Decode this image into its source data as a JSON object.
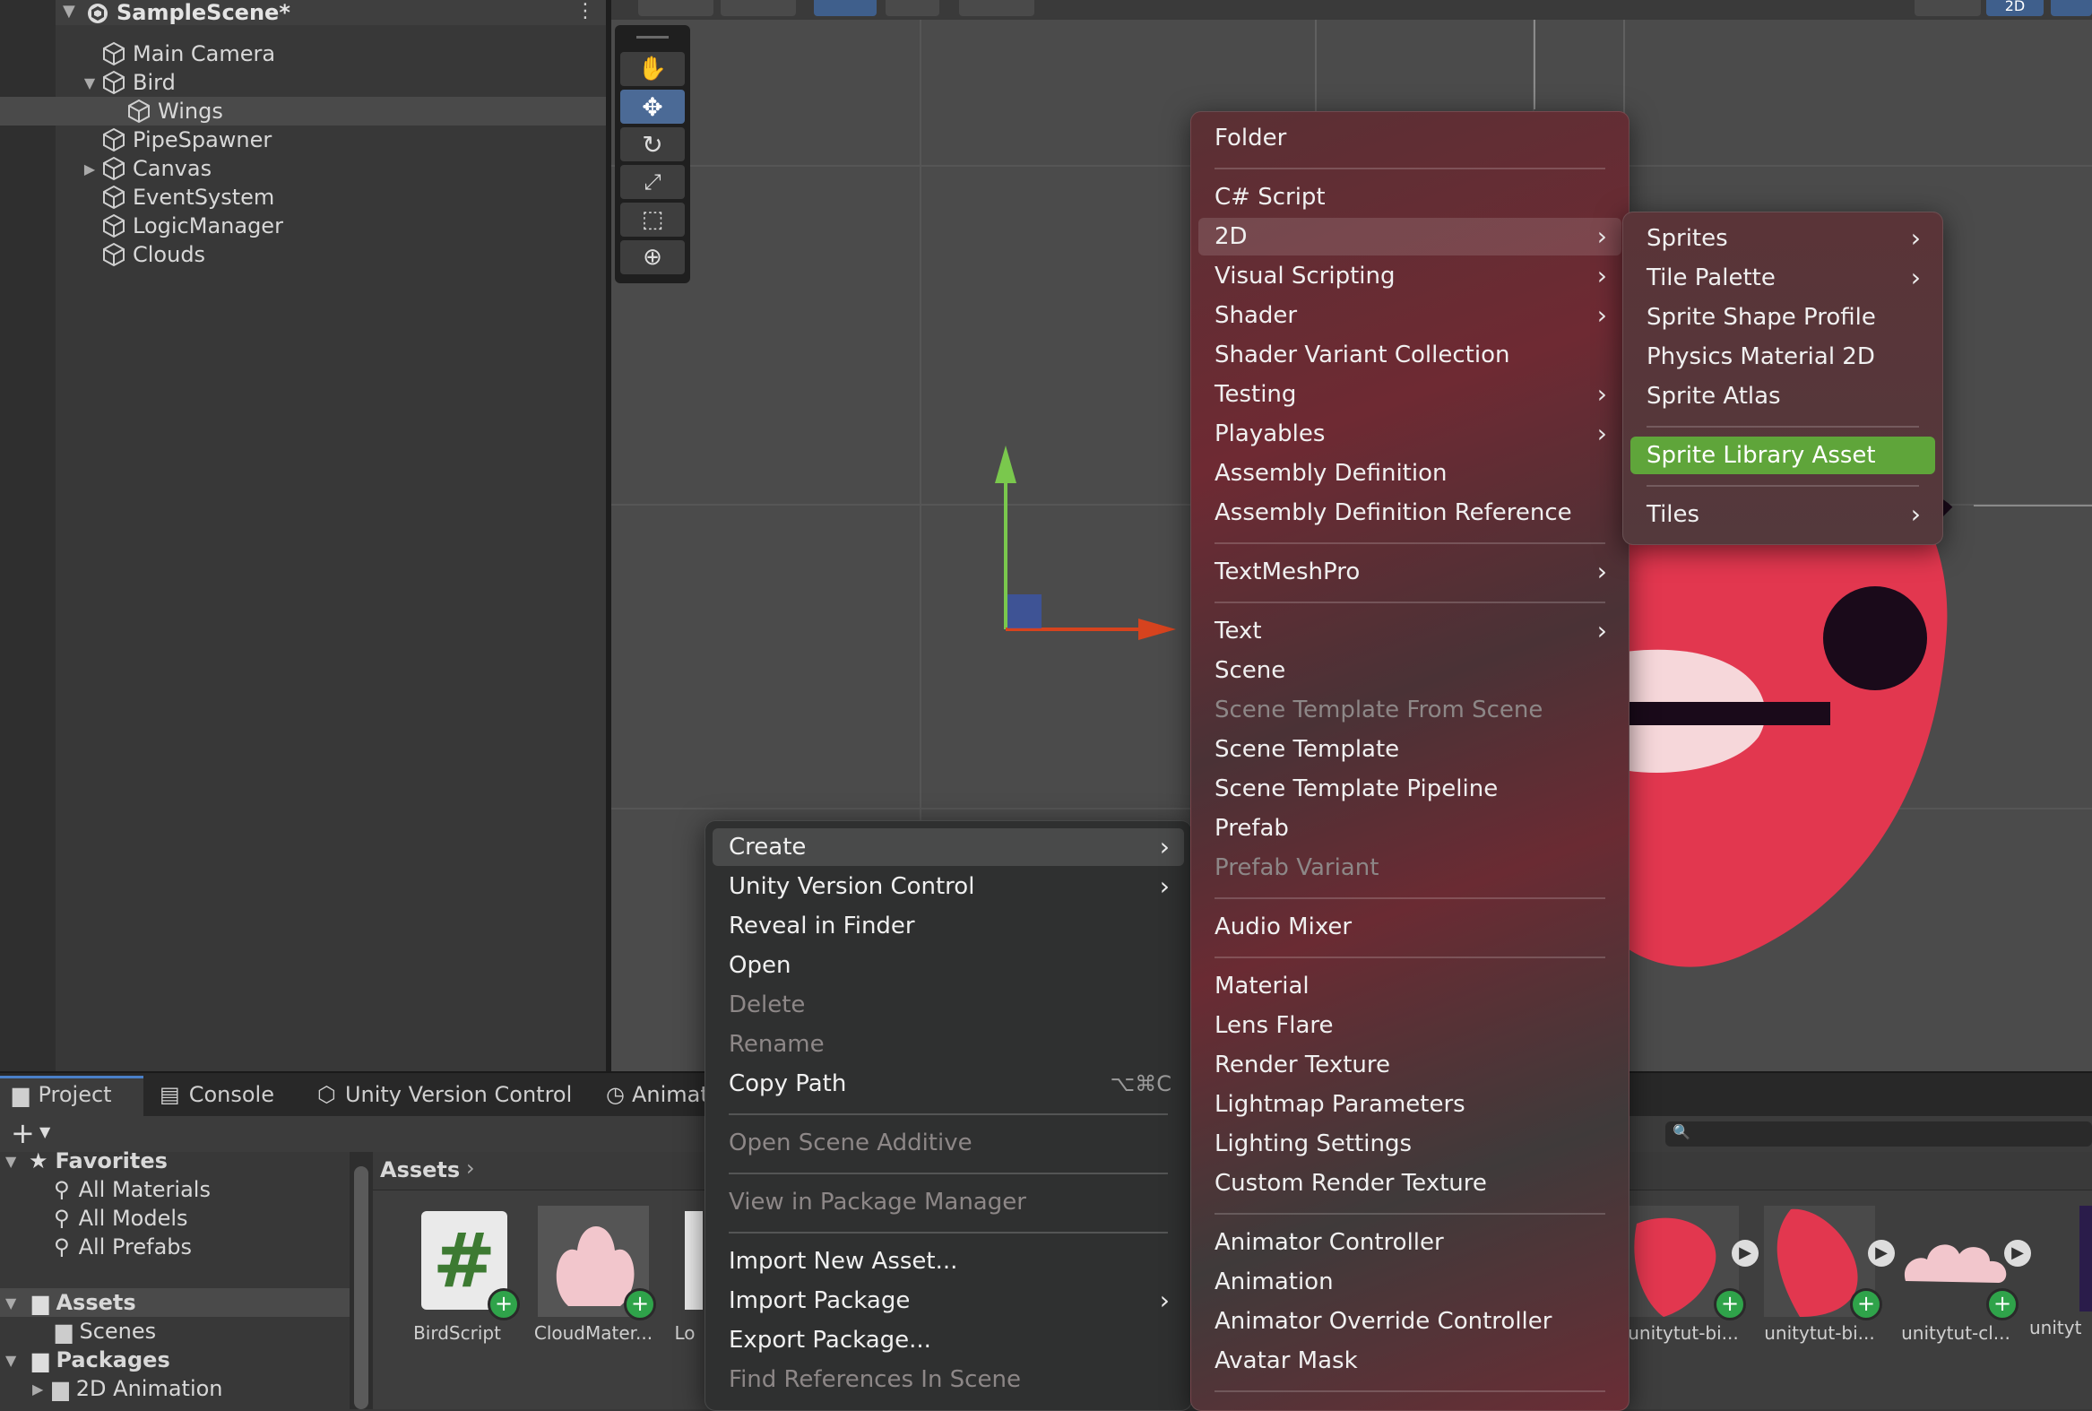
{
  "hierarchy": {
    "scene": "SampleScene*",
    "items": [
      {
        "label": "Main Camera",
        "indent": 1,
        "expander": "",
        "selected": false
      },
      {
        "label": "Bird",
        "indent": 1,
        "expander": "▼",
        "selected": false
      },
      {
        "label": "Wings",
        "indent": 2,
        "expander": "",
        "selected": true
      },
      {
        "label": "PipeSpawner",
        "indent": 1,
        "expander": "",
        "selected": false
      },
      {
        "label": "Canvas",
        "indent": 1,
        "expander": "▶",
        "selected": false
      },
      {
        "label": "EventSystem",
        "indent": 1,
        "expander": "",
        "selected": false
      },
      {
        "label": "LogicManager",
        "indent": 1,
        "expander": "",
        "selected": false
      },
      {
        "label": "Clouds",
        "indent": 1,
        "expander": "",
        "selected": false
      }
    ]
  },
  "scene_toolbar": {
    "mode_2d": "2D"
  },
  "tools": [
    "hand-tool-icon",
    "move-tool-icon",
    "rotate-tool-icon",
    "scale-tool-icon",
    "rect-tool-icon",
    "transform-tool-icon"
  ],
  "bottom_tabs": [
    "Project",
    "Console",
    "Unity Version Control",
    "Animat"
  ],
  "project": {
    "favorites_label": "Favorites",
    "favorites": [
      "All Materials",
      "All Models",
      "All Prefabs"
    ],
    "assets_label": "Assets",
    "assets_children": [
      "Scenes"
    ],
    "packages_label": "Packages",
    "packages_children": [
      "2D Animation"
    ],
    "breadcrumb": "Assets",
    "assets": [
      "BirdScript",
      "CloudMater...",
      "Lo",
      "unitytut-bi...",
      "unitytut-bi...",
      "unitytut-cl...",
      "unityt"
    ]
  },
  "menu_main": [
    {
      "label": "Create",
      "sub": true,
      "state": "hl"
    },
    {
      "label": "Unity Version Control",
      "sub": true
    },
    {
      "label": "Reveal in Finder"
    },
    {
      "label": "Open"
    },
    {
      "label": "Delete",
      "state": "dis"
    },
    {
      "label": "Rename",
      "state": "dis"
    },
    {
      "label": "Copy Path",
      "shortcut": "⌥⌘C"
    },
    {
      "sep": true
    },
    {
      "label": "Open Scene Additive",
      "state": "dis"
    },
    {
      "sep": true
    },
    {
      "label": "View in Package Manager",
      "state": "dis"
    },
    {
      "sep": true
    },
    {
      "label": "Import New Asset..."
    },
    {
      "label": "Import Package",
      "sub": true
    },
    {
      "label": "Export Package..."
    },
    {
      "label": "Find References In Scene",
      "state": "dis"
    }
  ],
  "menu_create": [
    {
      "label": "Folder"
    },
    {
      "sep": true
    },
    {
      "label": "C# Script"
    },
    {
      "label": "2D",
      "sub": true,
      "state": "hl"
    },
    {
      "label": "Visual Scripting",
      "sub": true
    },
    {
      "label": "Shader",
      "sub": true
    },
    {
      "label": "Shader Variant Collection"
    },
    {
      "label": "Testing",
      "sub": true
    },
    {
      "label": "Playables",
      "sub": true
    },
    {
      "label": "Assembly Definition"
    },
    {
      "label": "Assembly Definition Reference"
    },
    {
      "sep": true
    },
    {
      "label": "TextMeshPro",
      "sub": true
    },
    {
      "sep": true
    },
    {
      "label": "Text",
      "sub": true
    },
    {
      "label": "Scene"
    },
    {
      "label": "Scene Template From Scene",
      "state": "dis"
    },
    {
      "label": "Scene Template"
    },
    {
      "label": "Scene Template Pipeline"
    },
    {
      "label": "Prefab"
    },
    {
      "label": "Prefab Variant",
      "state": "dis"
    },
    {
      "sep": true
    },
    {
      "label": "Audio Mixer"
    },
    {
      "sep": true
    },
    {
      "label": "Material"
    },
    {
      "label": "Lens Flare"
    },
    {
      "label": "Render Texture"
    },
    {
      "label": "Lightmap Parameters"
    },
    {
      "label": "Lighting Settings"
    },
    {
      "label": "Custom Render Texture"
    },
    {
      "sep": true
    },
    {
      "label": "Animator Controller"
    },
    {
      "label": "Animation"
    },
    {
      "label": "Animator Override Controller"
    },
    {
      "label": "Avatar Mask"
    },
    {
      "sep": true
    }
  ],
  "menu_2d": [
    {
      "label": "Sprites",
      "sub": true
    },
    {
      "label": "Tile Palette",
      "sub": true
    },
    {
      "label": "Sprite Shape Profile"
    },
    {
      "label": "Physics Material 2D"
    },
    {
      "label": "Sprite Atlas"
    },
    {
      "sep": true
    },
    {
      "label": "Sprite Library Asset",
      "state": "green"
    },
    {
      "sep": true
    },
    {
      "label": "Tiles",
      "sub": true
    }
  ],
  "colors": {
    "highlight_green": "#5fa53a",
    "bird_red": "#e2374f",
    "script_green": "#3d7a32"
  }
}
